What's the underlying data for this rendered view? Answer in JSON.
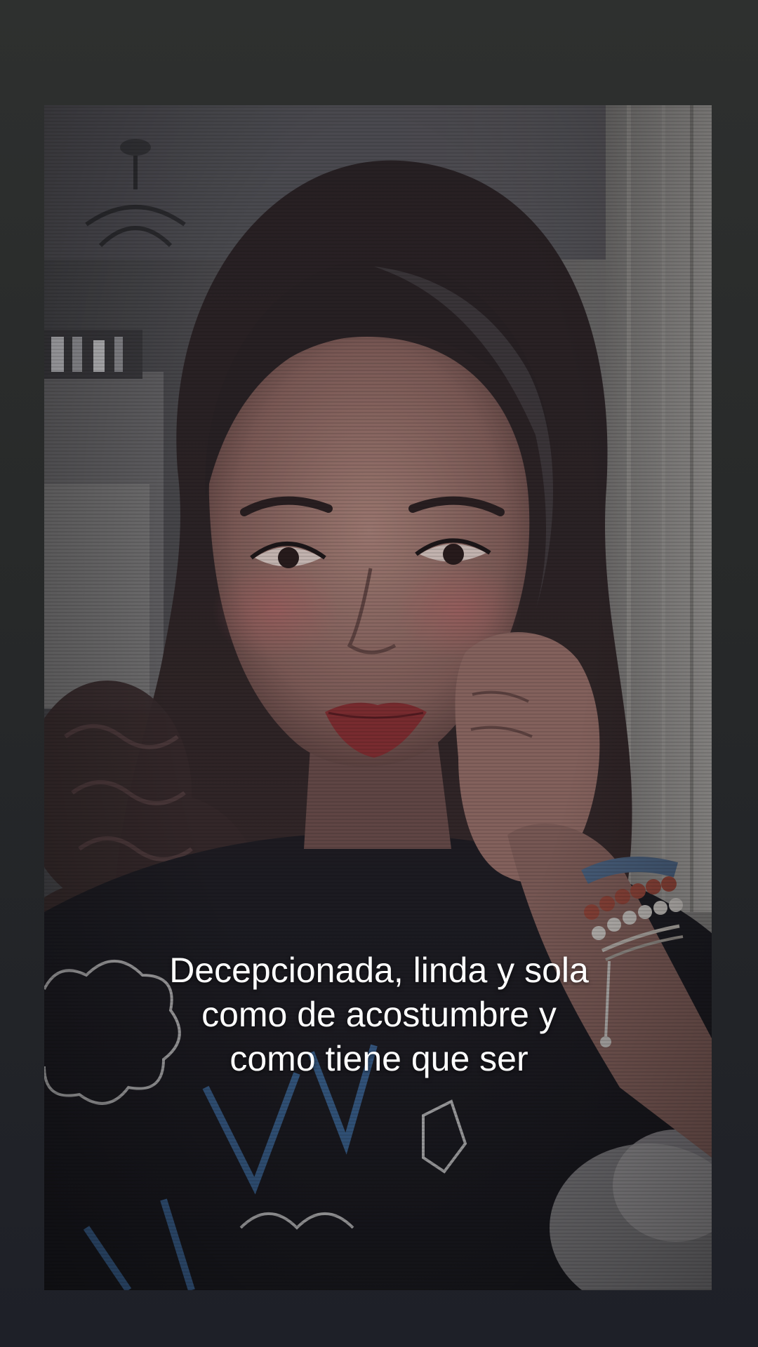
{
  "video": {
    "caption_lines": [
      "Decepcionada, linda y sola",
      "como de acostumbre y",
      "como tiene que ser"
    ]
  }
}
